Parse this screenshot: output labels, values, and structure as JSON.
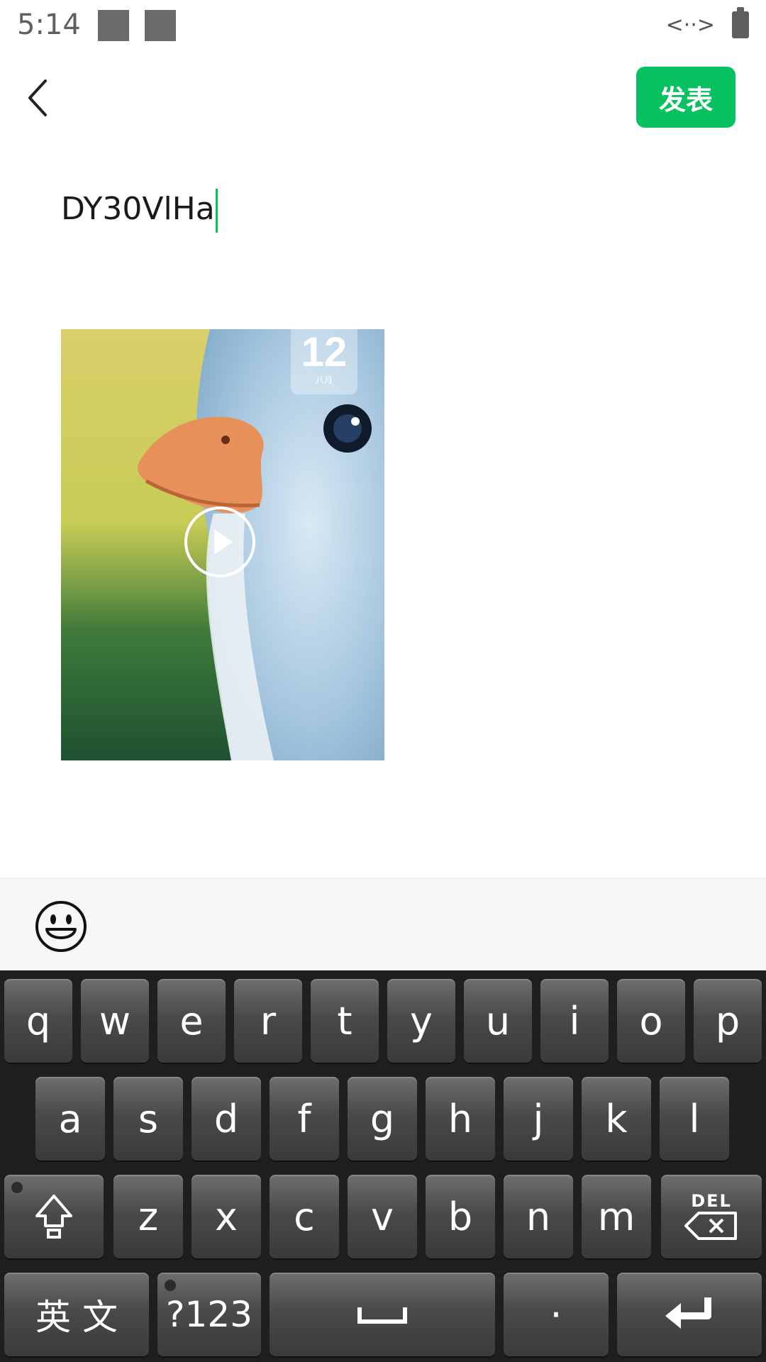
{
  "status_bar": {
    "time": "5:14",
    "code_icon_text": "<··>"
  },
  "header": {
    "publish_label": "发表"
  },
  "post": {
    "text": "DY30VlHa"
  },
  "video": {
    "overlay_number": "12",
    "overlay_sub": "八月"
  },
  "keyboard": {
    "row1": [
      "q",
      "w",
      "e",
      "r",
      "t",
      "y",
      "u",
      "i",
      "o",
      "p"
    ],
    "row2": [
      "a",
      "s",
      "d",
      "f",
      "g",
      "h",
      "j",
      "k",
      "l"
    ],
    "row3": [
      "z",
      "x",
      "c",
      "v",
      "b",
      "n",
      "m"
    ],
    "lang_label": "英 文",
    "symbols_label": "?123",
    "period_label": "·",
    "del_label": "DEL"
  },
  "colors": {
    "accent": "#07c160",
    "keyboard_bg": "#1f1f1f"
  }
}
